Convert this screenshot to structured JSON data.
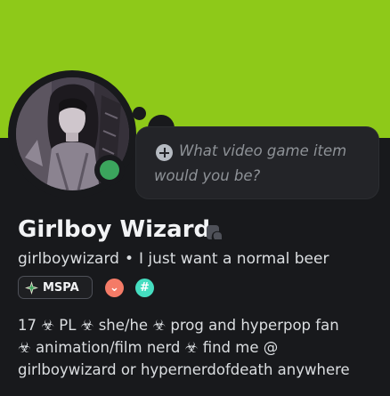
{
  "profile": {
    "display_name": "Girlboy Wizard",
    "username": "girlboywizard",
    "separator": "•",
    "custom_status": "I just want a normal beer",
    "status": "online",
    "status_color": "#3ba55d",
    "banner_color": "#8ec919"
  },
  "status_prompt": {
    "icon": "plus-circle-icon",
    "line1": "What video game item",
    "line2": "would you be?"
  },
  "badges": {
    "guild_tag": "MSPA",
    "guild_icon": "sparkle-icon",
    "items": [
      {
        "name": "hypesquad-badge",
        "symbol": "⌄",
        "color": "#f47b67"
      },
      {
        "name": "nitro-badge",
        "symbol": "#",
        "color": "#45ddc0"
      }
    ]
  },
  "bio": {
    "lines": [
      "17 ☣ PL ☣ she/he ☣ prog and hyperpop fan",
      "☣ animation/film nerd ☣ find me @",
      "girlboywizard or hypernerdofdeath anywhere"
    ]
  }
}
